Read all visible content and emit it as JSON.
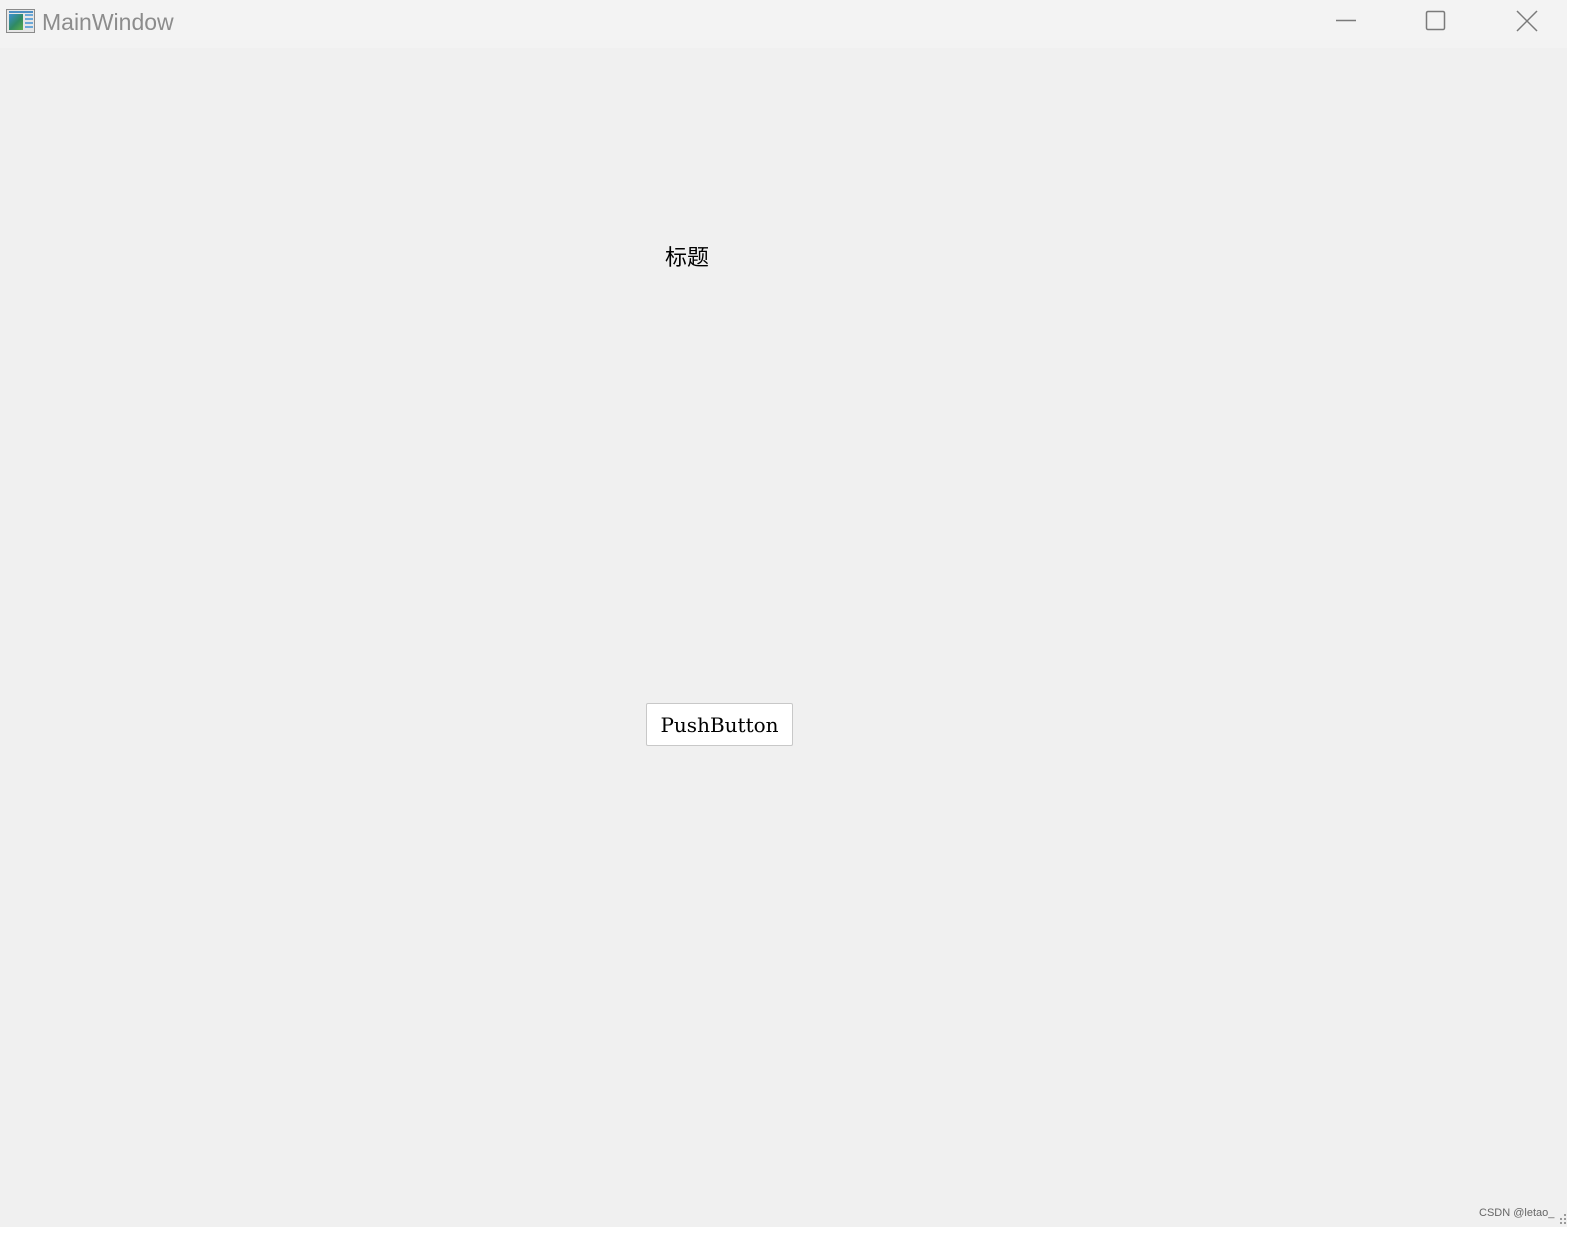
{
  "window": {
    "title": "MainWindow",
    "controls": {
      "minimize": "minimize-icon",
      "maximize": "maximize-icon",
      "close": "close-icon"
    }
  },
  "content": {
    "label_text": "标题",
    "button_label": "PushButton"
  },
  "watermark": "CSDN @letao_",
  "colors": {
    "window_background": "#f0f0f0",
    "titlebar_background": "#f3f3f3",
    "title_text": "#8c8c8c",
    "button_background": "#ffffff",
    "button_border": "#c8c8c8"
  }
}
